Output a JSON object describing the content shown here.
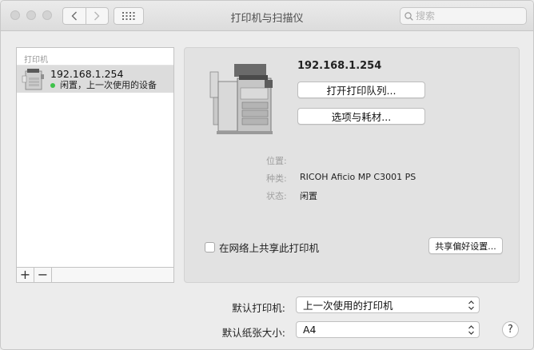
{
  "window": {
    "title": "打印机与扫描仪"
  },
  "search": {
    "placeholder": "搜索"
  },
  "printer_list": {
    "header": "打印机",
    "items": [
      {
        "name": "192.168.1.254",
        "status": "闲置，上一次使用的设备"
      }
    ],
    "add_label": "+",
    "remove_label": "−"
  },
  "detail": {
    "name": "192.168.1.254",
    "open_queue_label": "打开打印队列...",
    "options_label": "选项与耗材...",
    "location_label": "位置:",
    "location_value": "",
    "kind_label": "种类:",
    "kind_value": "RICOH Aficio MP C3001 PS",
    "status_label": "状态:",
    "status_value": "闲置",
    "share_label": "在网络上共享此打印机",
    "share_checked": false,
    "sharing_prefs_label": "共享偏好设置..."
  },
  "settings": {
    "default_printer_label": "默认打印机:",
    "default_printer_value": "上一次使用的打印机",
    "paper_size_label": "默认纸张大小:",
    "paper_size_value": "A4"
  },
  "help_label": "?",
  "colors": {
    "status_idle": "#3ec24a",
    "selection": "#dcdcdc"
  }
}
